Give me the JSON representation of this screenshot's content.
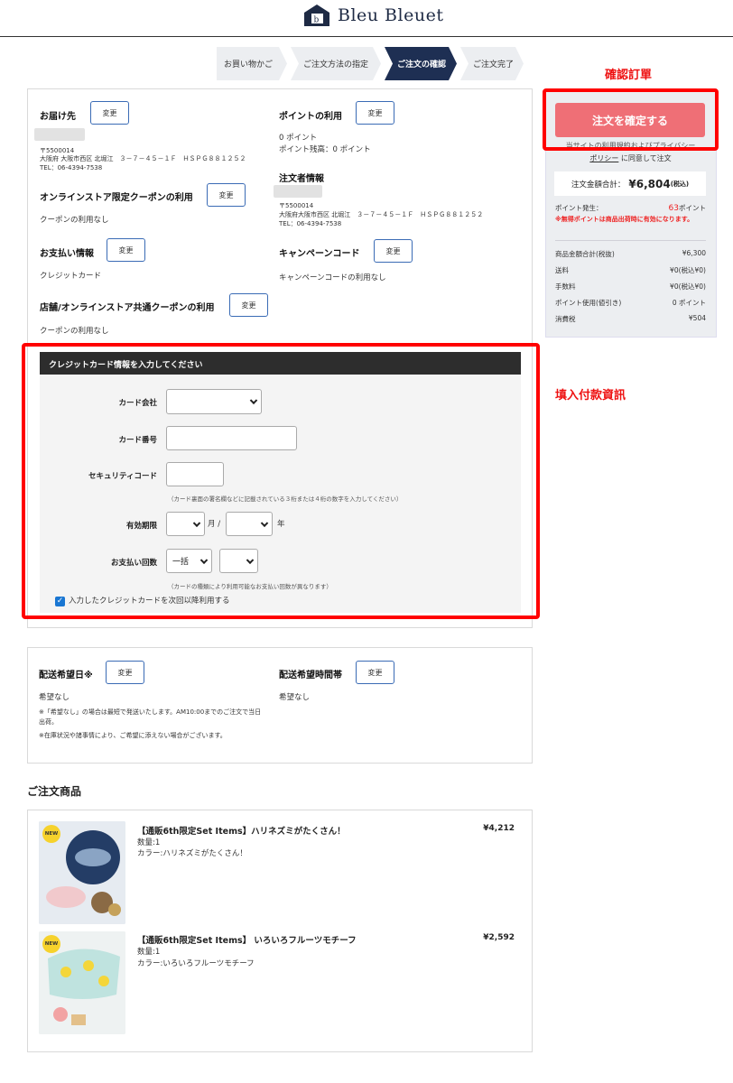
{
  "brand": {
    "name": "Bleu Bleuet"
  },
  "steps": [
    "お買い物かご",
    "ご注文方法の指定",
    "ご注文の確認",
    "ご注文完了"
  ],
  "annotations": {
    "confirm": "確認訂單",
    "payment": "填入付款資訊"
  },
  "shipping": {
    "title": "お届け先",
    "change": "変更",
    "postal": "〒5500014",
    "address": "大阪府 大阪市西区 北堀江　３－７－４５－１Ｆ　ＨＳＰＧ８８１２５２",
    "tel": "TEL：06-4394-7538"
  },
  "points": {
    "title": "ポイントの利用",
    "change": "変更",
    "used": "0 ポイント",
    "balance": "ポイント残高：0 ポイント"
  },
  "orderer": {
    "title": "注文者情報",
    "postal": "〒5500014",
    "address": "大阪府大阪市西区 北堀江　３－７－４５－１Ｆ　ＨＳＰＧ８８１２５２",
    "tel": "TEL：06-4394-7538"
  },
  "online_coupon": {
    "title": "オンラインストア限定クーポンの利用",
    "change": "変更",
    "value": "クーポンの利用なし"
  },
  "payment_info": {
    "title": "お支払い情報",
    "change": "変更",
    "value": "クレジットカード"
  },
  "campaign": {
    "title": "キャンペーンコード",
    "change": "変更",
    "value": "キャンペーンコードの利用なし"
  },
  "shared_coupon": {
    "title": "店舗/オンラインストア共通クーポンの利用",
    "change": "変更",
    "value": "クーポンの利用なし"
  },
  "credit_card": {
    "header": "クレジットカード情報を入力してください",
    "company_label": "カード会社",
    "number_label": "カード番号",
    "security_label": "セキュリティコード",
    "security_hint": "（カード裏面の署名欄などに記載されている３桁または４桁の数字を入力してください）",
    "expiry_label": "有効期限",
    "month_unit": "月 /",
    "year_unit": "年",
    "installment_label": "お支払い回数",
    "installment_value": "一括",
    "installment_hint": "（カードの種類により利用可能なお支払い回数が異なります）",
    "save_card": "入力したクレジットカードを次回以降利用する"
  },
  "summary": {
    "confirm_button": "注文を確定する",
    "agree_line1": "当サイトの利用規約およびプライバシー",
    "agree_link": "ポリシー",
    "agree_line2": "に同意して注文",
    "total_label": "注文金額合計：",
    "total_value": "¥6,804",
    "total_tax": "(税込)",
    "points_label": "ポイント発生：",
    "points_value": "63",
    "points_unit": "ポイント",
    "points_note": "※無得ポイントは商品出荷時に有効になります。",
    "rows": [
      {
        "label": "商品金額合計(税抜)",
        "value": "¥6,300"
      },
      {
        "label": "送料",
        "value": "¥0(税込¥0)"
      },
      {
        "label": "手数料",
        "value": "¥0(税込¥0)"
      },
      {
        "label": "ポイント使用(値引き)",
        "value": "0 ポイント"
      },
      {
        "label": "消費税",
        "value": "¥504"
      }
    ]
  },
  "delivery": {
    "date_title": "配送希望日※",
    "date_change": "変更",
    "date_value": "希望なし",
    "time_title": "配送希望時間帯",
    "time_change": "変更",
    "time_value": "希望なし",
    "note1": "※「希望なし」の場合は最短で発送いたします。AM10:00までのご注文で当日",
    "note1b": "出荷。",
    "note2": "※在庫状況や諸事情により、ご希望に添えない場合がございます。"
  },
  "products_title": "ご注文商品",
  "products": [
    {
      "badge": "NEW",
      "name": "【通販6th限定Set Items】ハリネズミがたくさん！",
      "qty": "数量:1",
      "color": "カラー:ハリネズミがたくさん！",
      "price": "¥4,212"
    },
    {
      "badge": "NEW",
      "name": "【通販6th限定Set Items】 いろいろフルーツモチーフ",
      "qty": "数量:1",
      "color": "カラー:いろいろフルーツモチーフ",
      "price": "¥2,592"
    }
  ]
}
